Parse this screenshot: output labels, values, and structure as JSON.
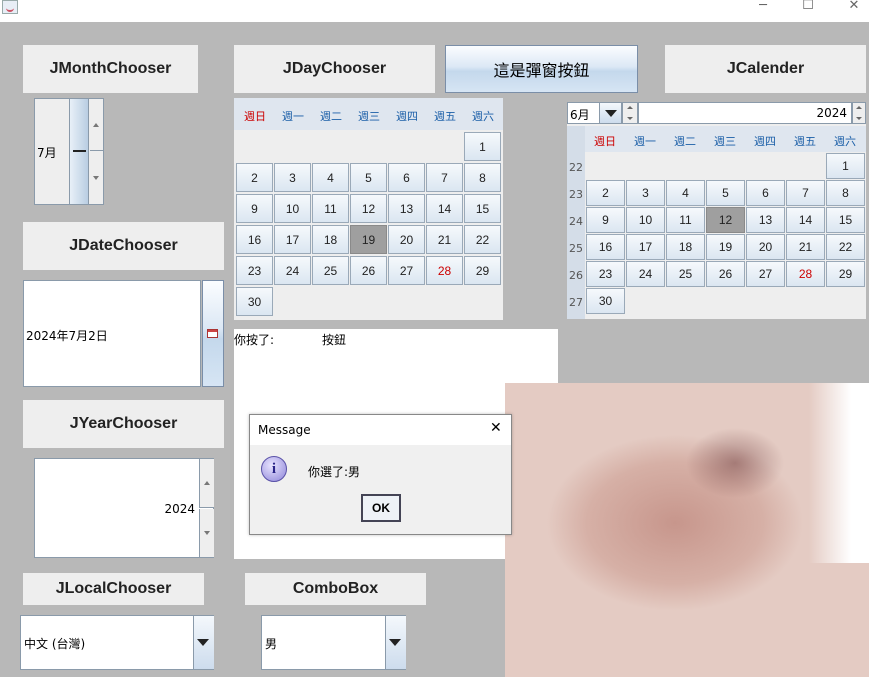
{
  "window": {
    "icon": "java-icon",
    "controls": {
      "minimize": "─",
      "maximize": "☐",
      "close": "✕"
    }
  },
  "labels": {
    "month_chooser": "JMonthChooser",
    "day_chooser": "JDayChooser",
    "popup_button": "這是彈窗按鈕",
    "calendar": "JCalender",
    "date_chooser": "JDateChooser",
    "year_chooser": "JYearChooser",
    "local_chooser": "JLocalChooser",
    "combobox": "ComboBox"
  },
  "month_chooser": {
    "value": "7月"
  },
  "date_chooser": {
    "value": "2024年7月2日",
    "button_icon": "calendar-icon"
  },
  "year_chooser": {
    "value": "2024"
  },
  "locale_chooser": {
    "value": "中文 (台灣)"
  },
  "combobox": {
    "value": "男"
  },
  "day_chooser": {
    "weekdays": [
      "週日",
      "週一",
      "週二",
      "週三",
      "週四",
      "週五",
      "週六"
    ],
    "days": [
      "1",
      "2",
      "3",
      "4",
      "5",
      "6",
      "7",
      "8",
      "9",
      "10",
      "11",
      "12",
      "13",
      "14",
      "15",
      "16",
      "17",
      "18",
      "19",
      "20",
      "21",
      "22",
      "23",
      "24",
      "25",
      "26",
      "27",
      "28",
      "29",
      "30"
    ],
    "selected": "19",
    "red_day": "28"
  },
  "calendar": {
    "month": "6月",
    "year": "2024",
    "weekdays": [
      "週日",
      "週一",
      "週二",
      "週三",
      "週四",
      "週五",
      "週六"
    ],
    "week_numbers": [
      "22",
      "23",
      "24",
      "25",
      "26",
      "27"
    ],
    "days": [
      "1",
      "2",
      "3",
      "4",
      "5",
      "6",
      "7",
      "8",
      "9",
      "10",
      "11",
      "12",
      "13",
      "14",
      "15",
      "16",
      "17",
      "18",
      "19",
      "20",
      "21",
      "22",
      "23",
      "24",
      "25",
      "26",
      "27",
      "28",
      "29",
      "30"
    ],
    "selected": "12",
    "red_day": "28"
  },
  "text_area": {
    "prefix": "你按了:",
    "value": "按鈕"
  },
  "dialog": {
    "title": "Message",
    "close": "✕",
    "message": "你選了:男",
    "ok": "OK",
    "icon": "info-icon"
  }
}
